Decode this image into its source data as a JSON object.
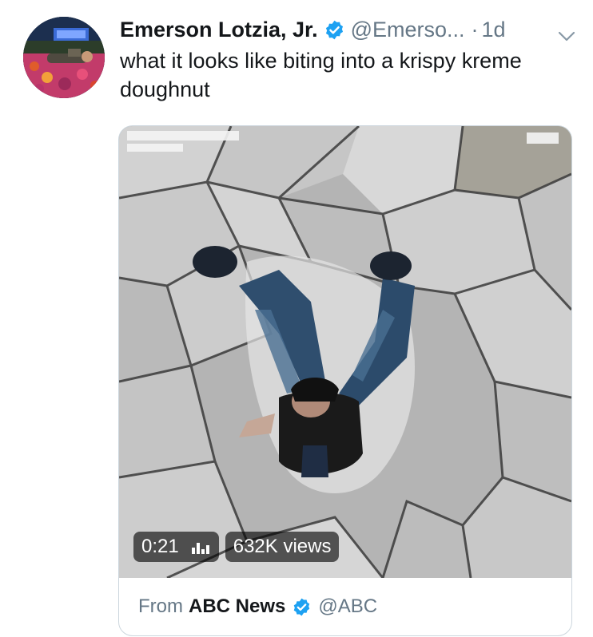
{
  "tweet": {
    "display_name": "Emerson Lotzia, Jr.",
    "handle": "@Emerso...",
    "separator": "·",
    "time": "1d",
    "text": "what it looks like biting into a krispy kreme doughnut",
    "verified": true,
    "avatar_icon": "avatar-photo"
  },
  "media": {
    "duration": "0:21",
    "views": "632K views",
    "stats_icon": "bar-chart-icon",
    "from_label": "From",
    "source_name": "ABC News",
    "source_handle": "@ABC",
    "source_verified": true
  },
  "colors": {
    "verified_blue": "#1da1f2",
    "secondary_text": "#657786",
    "primary_text": "#14171a",
    "border": "#ccd6dd"
  }
}
